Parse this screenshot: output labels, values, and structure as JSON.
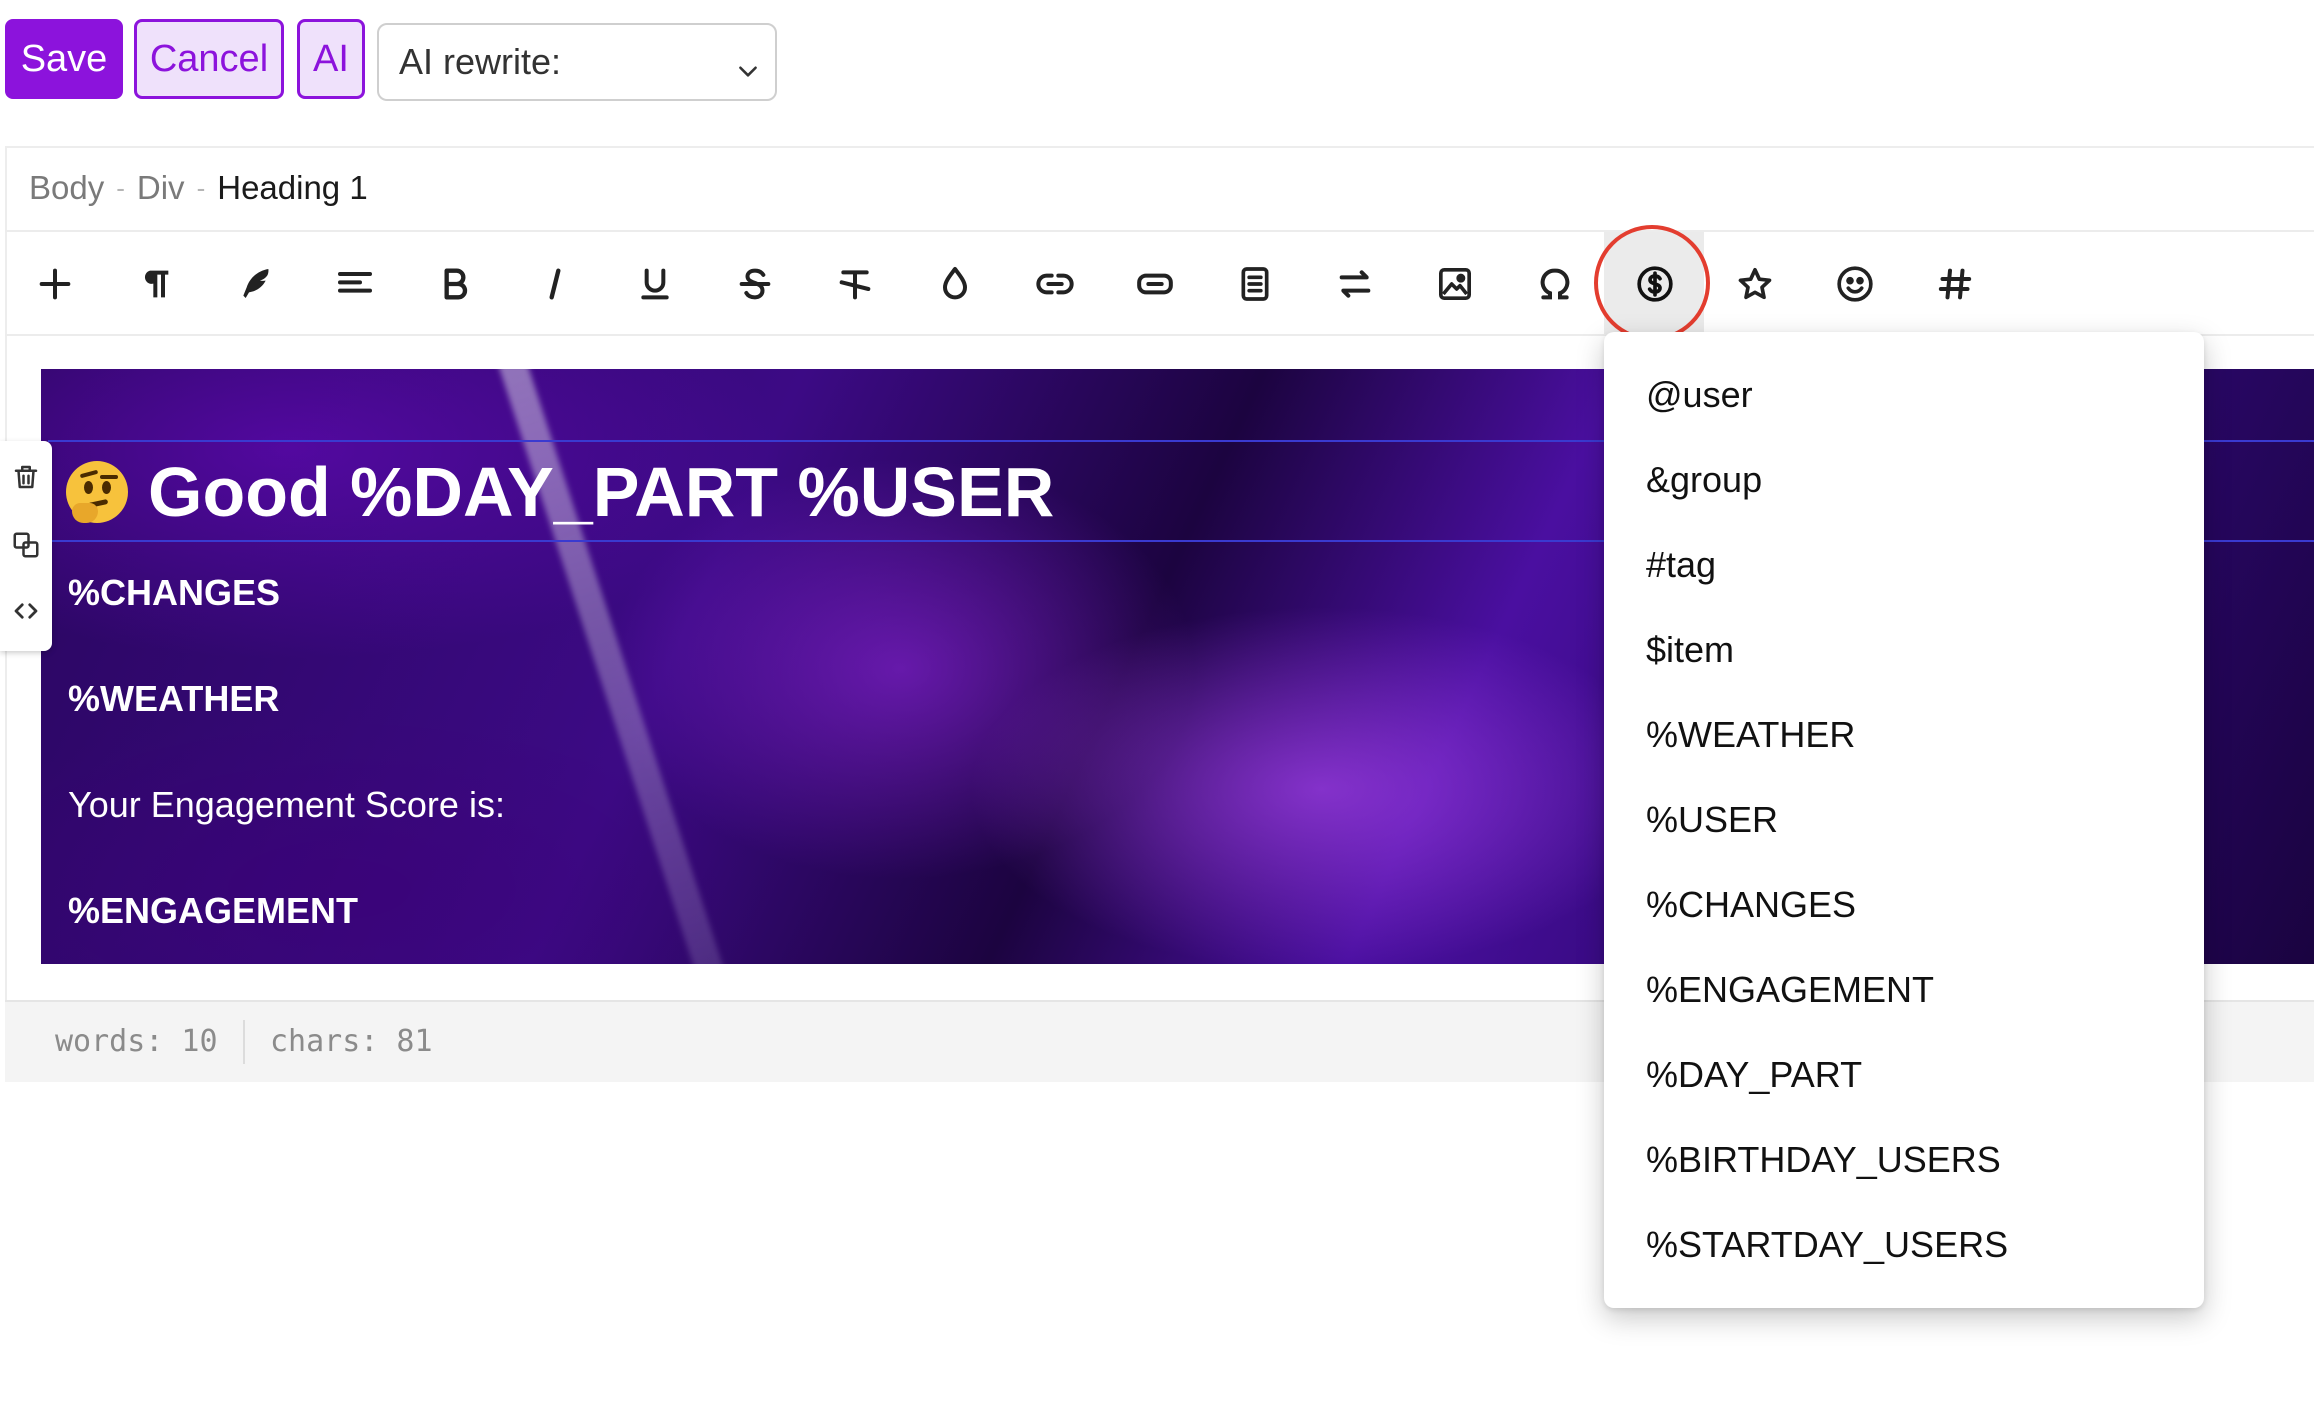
{
  "actions": {
    "save_label": "Save",
    "cancel_label": "Cancel",
    "ai_label": "AI",
    "ai_rewrite_placeholder": "AI rewrite:"
  },
  "colors": {
    "accent": "#8c13dc",
    "accent_light": "#efe1fb",
    "highlight_ring": "#e33d2f",
    "selection_outline": "#3a3ad0"
  },
  "breadcrumb": [
    "Body",
    "Div",
    "Heading 1"
  ],
  "toolbar": {
    "tools": [
      "plus-icon",
      "paragraph-icon",
      "feather-icon",
      "align-icon",
      "bold-icon",
      "italic-icon",
      "underline-icon",
      "strikethrough-icon",
      "clear-format-icon",
      "color-drop-icon",
      "link-icon",
      "button-icon",
      "document-icon",
      "swap-icon",
      "image-icon",
      "special-char-icon",
      "variable-dollar-icon",
      "star-icon",
      "emoji-icon",
      "hash-icon"
    ],
    "active_tool": "variable-dollar-icon"
  },
  "side_actions": [
    "trash-icon",
    "duplicate-icon",
    "code-icon"
  ],
  "content": {
    "heading": "Good %DAY_PART %USER",
    "heading_emoji": "thinking-face-emoji",
    "lines": [
      {
        "text": "%CHANGES",
        "bold": true
      },
      {
        "text": "%WEATHER",
        "bold": true
      },
      {
        "text": "Your Engagement Score is:",
        "bold": false
      },
      {
        "text": "%ENGAGEMENT",
        "bold": true
      }
    ]
  },
  "status": {
    "words": "words: 10",
    "chars": "chars: 81"
  },
  "variables_menu": [
    "@user",
    "&group",
    "#tag",
    "$item",
    "%WEATHER",
    "%USER",
    "%CHANGES",
    "%ENGAGEMENT",
    "%DAY_PART",
    "%BIRTHDAY_USERS",
    "%STARTDAY_USERS"
  ]
}
